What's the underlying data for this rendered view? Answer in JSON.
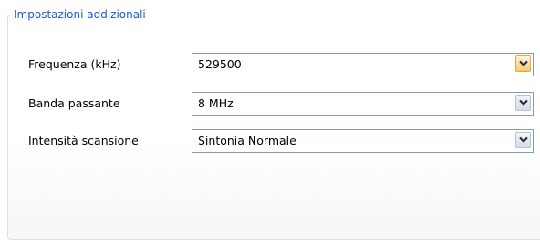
{
  "group": {
    "title": "Impostazioni addizionali"
  },
  "fields": [
    {
      "label": "Frequenza (kHz)",
      "value": "529500"
    },
    {
      "label": "Banda passante",
      "value": "8 MHz"
    },
    {
      "label": "Intensità scansione",
      "value": "Sintonia Normale"
    }
  ],
  "colors": {
    "legend_text": "#1c5ad8",
    "combo_border": "#7f9db9",
    "active_button_border": "#e5a447"
  },
  "icons": {
    "dropdown": "chevron-down-icon"
  }
}
